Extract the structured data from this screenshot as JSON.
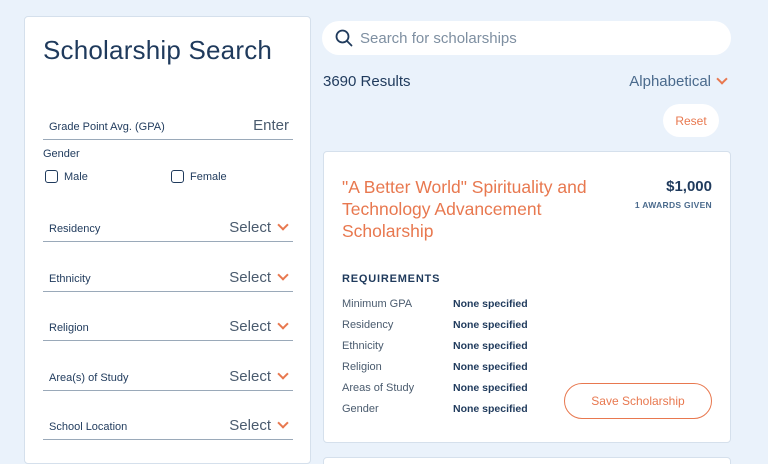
{
  "sidebar": {
    "title": "Scholarship Search",
    "gpa": {
      "label": "Grade Point Avg. (GPA)",
      "value": "Enter"
    },
    "gender": {
      "label": "Gender",
      "options": [
        "Male",
        "Female"
      ]
    },
    "filters": [
      {
        "label": "Residency",
        "value": "Select"
      },
      {
        "label": "Ethnicity",
        "value": "Select"
      },
      {
        "label": "Religion",
        "value": "Select"
      },
      {
        "label": "Area(s) of Study",
        "value": "Select"
      },
      {
        "label": "School Location",
        "value": "Select"
      }
    ]
  },
  "search": {
    "placeholder": "Search for scholarships"
  },
  "results": {
    "count_text": "3690 Results",
    "sort_label": "Alphabetical",
    "reset_label": "Reset"
  },
  "card": {
    "title": "\"A Better World\" Spirituality and Technology Advancement Scholarship",
    "amount": "$1,000",
    "awards": "1 AWARDS GIVEN",
    "requirements_heading": "REQUIREMENTS",
    "requirements": [
      {
        "key": "Minimum GPA",
        "value": "None specified"
      },
      {
        "key": "Residency",
        "value": "None specified"
      },
      {
        "key": "Ethnicity",
        "value": "None specified"
      },
      {
        "key": "Religion",
        "value": "None specified"
      },
      {
        "key": "Areas of Study",
        "value": "None specified"
      },
      {
        "key": "Gender",
        "value": "None specified"
      }
    ],
    "save_label": "Save Scholarship"
  },
  "colors": {
    "accent": "#e8784f",
    "navy": "#1f3a5c",
    "background": "#eaf2fb"
  }
}
